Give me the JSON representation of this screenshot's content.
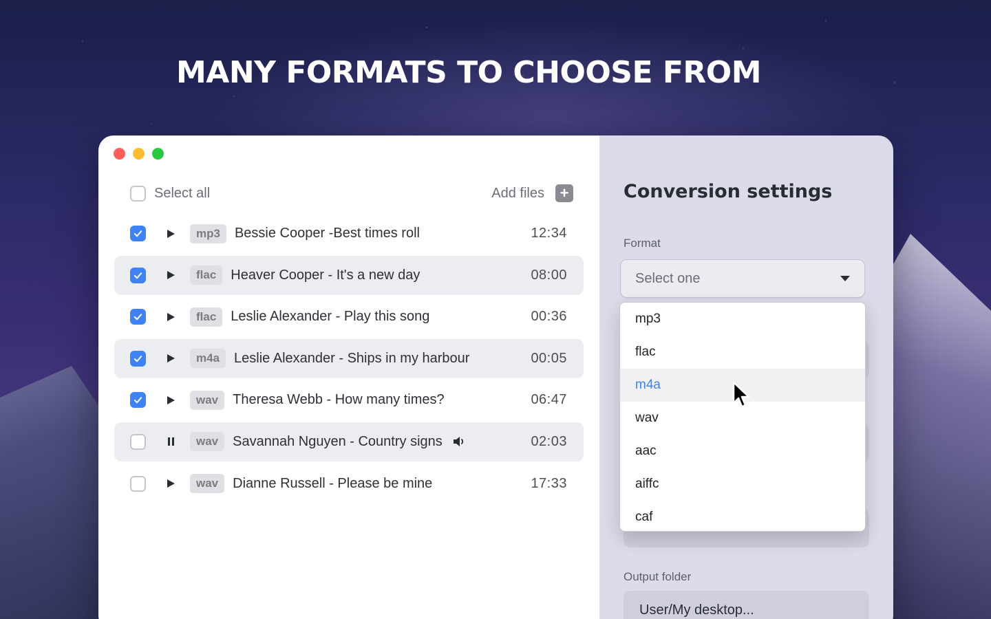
{
  "headline": "MANY FORMATS TO CHOOSE FROM",
  "toolbar": {
    "select_all_label": "Select all",
    "add_files_label": "Add files",
    "add_icon": "plus-icon"
  },
  "files": [
    {
      "checked": true,
      "state": "play",
      "format": "mp3",
      "title": "Bessie Cooper -Best times roll",
      "duration": "12:34",
      "shaded": false,
      "playing": false
    },
    {
      "checked": true,
      "state": "play",
      "format": "flac",
      "title": "Heaver Cooper - It's a new day",
      "duration": "08:00",
      "shaded": true,
      "playing": false
    },
    {
      "checked": true,
      "state": "play",
      "format": "flac",
      "title": "Leslie Alexander - Play this song",
      "duration": "00:36",
      "shaded": false,
      "playing": false
    },
    {
      "checked": true,
      "state": "play",
      "format": "m4a",
      "title": "Leslie Alexander  - Ships in my harbour",
      "duration": "00:05",
      "shaded": true,
      "playing": false
    },
    {
      "checked": true,
      "state": "play",
      "format": "wav",
      "title": "Theresa Webb - How many times?",
      "duration": "06:47",
      "shaded": false,
      "playing": false
    },
    {
      "checked": false,
      "state": "pause",
      "format": "wav",
      "title": "Savannah Nguyen - Country signs",
      "duration": "02:03",
      "shaded": true,
      "playing": true
    },
    {
      "checked": false,
      "state": "play",
      "format": "wav",
      "title": "Dianne Russell - Please be mine",
      "duration": "17:33",
      "shaded": false,
      "playing": false
    }
  ],
  "settings": {
    "title": "Conversion settings",
    "format_label": "Format",
    "format_placeholder": "Select one",
    "format_options": [
      "mp3",
      "flac",
      "m4a",
      "wav",
      "aac",
      "aiffc",
      "caf"
    ],
    "hovered_option": "m4a",
    "output_folder_label": "Output folder",
    "output_folder_value": "User/My desktop..."
  },
  "colors": {
    "accent": "#3e82f7",
    "close": "#ff5f57",
    "minimize": "#febc2e",
    "zoom": "#28c840"
  }
}
